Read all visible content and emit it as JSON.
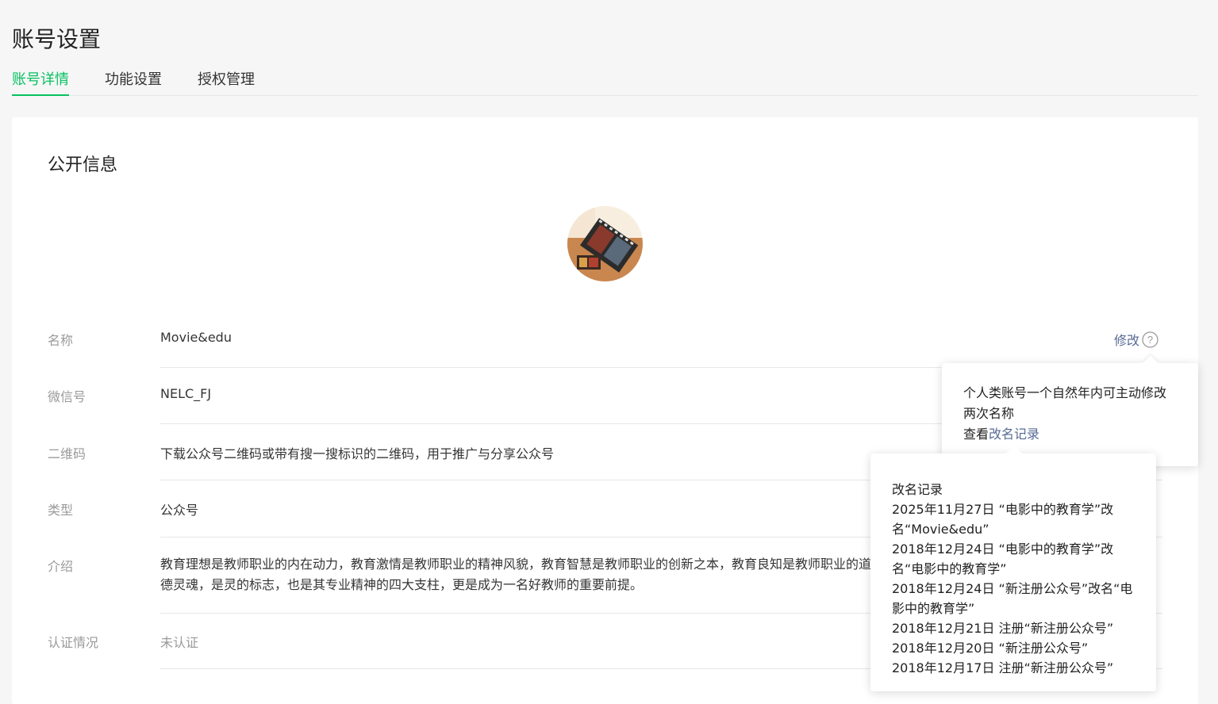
{
  "page": {
    "title": "账号设置"
  },
  "tabs": [
    {
      "label": "账号详情",
      "active": true
    },
    {
      "label": "功能设置",
      "active": false
    },
    {
      "label": "授权管理",
      "active": false
    }
  ],
  "section": {
    "title": "公开信息"
  },
  "rows": {
    "name": {
      "label": "名称",
      "value": "Movie&edu",
      "action": "修改"
    },
    "wechat_id": {
      "label": "微信号",
      "value": "NELC_FJ"
    },
    "qrcode": {
      "label": "二维码",
      "value": "下载公众号二维码或带有搜一搜标识的二维码，用于推广与分享公众号"
    },
    "type": {
      "label": "类型",
      "value": "公众号"
    },
    "intro": {
      "label": "介绍",
      "value": "教育理想是教师职业的内在动力，教育激情是教师职业的精神风貌，教育智慧是教师职业的创新之本，教育良知是教师职业的道德灵魂，是灵的标志，也是其专业精神的四大支柱，更是成为一名好教师的重要前提。"
    },
    "verify": {
      "label": "认证情况",
      "value": "未认证"
    }
  },
  "tooltip_rename": {
    "text": "个人类账号一个自然年内可主动修改两次名称",
    "view_prefix": "查看",
    "view_link": "改名记录"
  },
  "rename_history": {
    "title": "改名记录",
    "entries": [
      "2025年11月27日 “电影中的教育学”改名“Movie&edu”",
      "2018年12月24日 “电影中的教育学”改名“电影中的教育学”",
      "2018年12月24日 “新注册公众号”改名“电影中的教育学”",
      "2018年12月21日 注册“新注册公众号”",
      "2018年12月20日 “新注册公众号”",
      "2018年12月17日 注册“新注册公众号”"
    ]
  },
  "icons": {
    "help": "question-circle-icon"
  },
  "colors": {
    "accent": "#07c160",
    "link": "#576b95"
  }
}
